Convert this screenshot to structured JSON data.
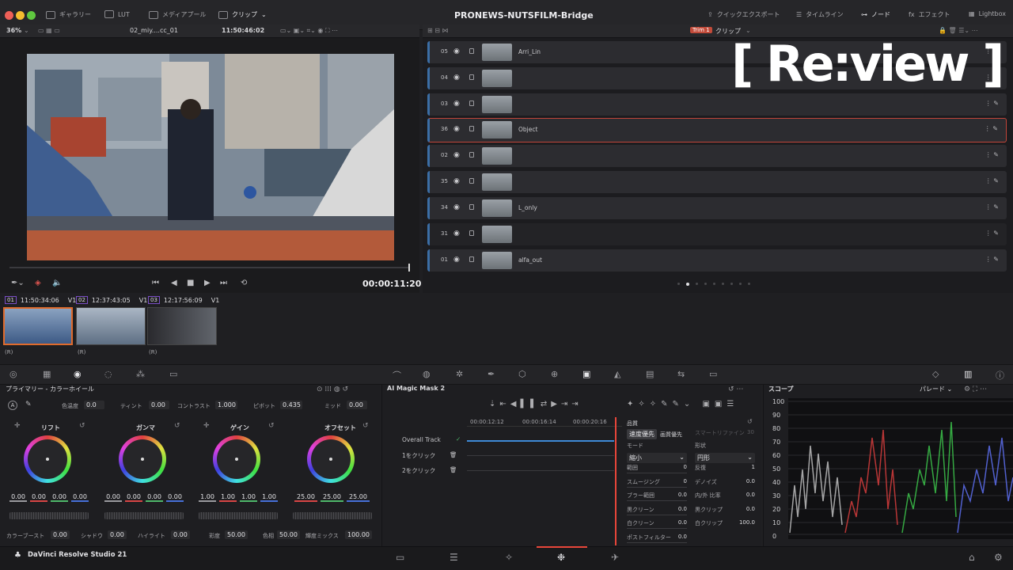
{
  "window": {
    "title": "PRONEWS-NUTSFILM-Bridge",
    "traffic_colors": [
      "#ee5f57",
      "#f5bd2f",
      "#5fc73f"
    ]
  },
  "topbar": {
    "left_items": [
      "ギャラリー",
      "LUT",
      "メディアプール",
      "クリップ"
    ],
    "right_items": [
      "クイックエクスポート",
      "タイムライン",
      "ノード",
      "エフェクト",
      "Lightbox"
    ]
  },
  "viewer": {
    "zoom": "36%",
    "clip_name": "02_miy....cc_01",
    "timecode_top": "11:50:46:02",
    "timecode": "00:00:11:20"
  },
  "layers": {
    "trim_label": "Trim 1",
    "dropdown": "クリップ",
    "rows": [
      {
        "num": "05",
        "label": "Arri_Lin",
        "selected": false
      },
      {
        "num": "04",
        "label": "",
        "selected": false
      },
      {
        "num": "03",
        "label": "",
        "selected": false
      },
      {
        "num": "36",
        "label": "Object",
        "selected": true
      },
      {
        "num": "02",
        "label": "",
        "selected": false
      },
      {
        "num": "35",
        "label": "",
        "selected": false
      },
      {
        "num": "34",
        "label": "L_only",
        "selected": false
      },
      {
        "num": "31",
        "label": "",
        "selected": false
      },
      {
        "num": "01",
        "label": "alfa_out",
        "selected": false
      }
    ]
  },
  "watermark": "[ Re:view ]",
  "clips": [
    {
      "num": "01",
      "tc": "11:50:34:06",
      "track": "V1",
      "flag": "(R)"
    },
    {
      "num": "02",
      "tc": "12:37:43:05",
      "track": "V1",
      "flag": "(R)"
    },
    {
      "num": "03",
      "tc": "12:17:56:09",
      "track": "V1",
      "flag": "(R)"
    }
  ],
  "primary": {
    "title": "プライマリー - カラーホイール",
    "temp_label": "色温度",
    "temp": "0.0",
    "tint_label": "ティント",
    "tint": "0.00",
    "contrast_label": "コントラスト",
    "contrast": "1.000",
    "pivot_label": "ピボット",
    "pivot": "0.435",
    "mid_label": "ミッド",
    "mid": "0.00",
    "wheels": [
      {
        "name": "リフト",
        "values": [
          "0.00",
          "0.00",
          "0.00",
          "0.00"
        ]
      },
      {
        "name": "ガンマ",
        "values": [
          "0.00",
          "0.00",
          "0.00",
          "0.00"
        ]
      },
      {
        "name": "ゲイン",
        "values": [
          "1.00",
          "1.00",
          "1.00",
          "1.00"
        ]
      },
      {
        "name": "オフセット",
        "values": [
          "25.00",
          "25.00",
          "25.00"
        ]
      }
    ],
    "boost_label": "カラーブースト",
    "boost": "0.00",
    "shadow_label": "シャドウ",
    "shadow": "0.00",
    "highlight_label": "ハイライト",
    "highlight": "0.00",
    "sat_label": "彩度",
    "sat": "50.00",
    "hue_label": "色相",
    "hue": "50.00",
    "lummix_label": "輝度ミックス",
    "lummix": "100.00"
  },
  "mask": {
    "title": "AI Magic Mask 2",
    "ticks": [
      "00:00:12:12",
      "00:00:16:14",
      "00:00:20:16"
    ],
    "tracks": [
      "Overall Track",
      "1をクリック",
      "2をクリック"
    ],
    "quality_label": "品質",
    "speed_tab": "速度優先",
    "quality_tab": "画質優先",
    "smart_label": "スマートリファイン",
    "smart_val": "30",
    "mode_label": "モード",
    "mode_val": "縮小",
    "shape_label": "形状",
    "shape_val": "円形",
    "params": [
      {
        "l": "範囲",
        "v": "0",
        "r": "反復",
        "rv": "1"
      },
      {
        "l": "スムージング",
        "v": "0",
        "r": "デノイズ",
        "rv": "0.0"
      },
      {
        "l": "ブラー範囲",
        "v": "0.0",
        "r": "内/外 比率",
        "rv": "0.0"
      },
      {
        "l": "黒クリーン",
        "v": "0.0",
        "r": "黒クリップ",
        "rv": "0.0"
      },
      {
        "l": "白クリーン",
        "v": "0.0",
        "r": "白クリップ",
        "rv": "100.0"
      },
      {
        "l": "ポストフィルター",
        "v": "0.0",
        "r": "",
        "rv": ""
      }
    ]
  },
  "scope": {
    "title": "スコープ",
    "mode": "パレード",
    "y_labels": [
      "100",
      "90",
      "80",
      "70",
      "60",
      "50",
      "40",
      "30",
      "20",
      "10",
      "0"
    ]
  },
  "app": {
    "name": "DaVinci Resolve Studio 21"
  }
}
